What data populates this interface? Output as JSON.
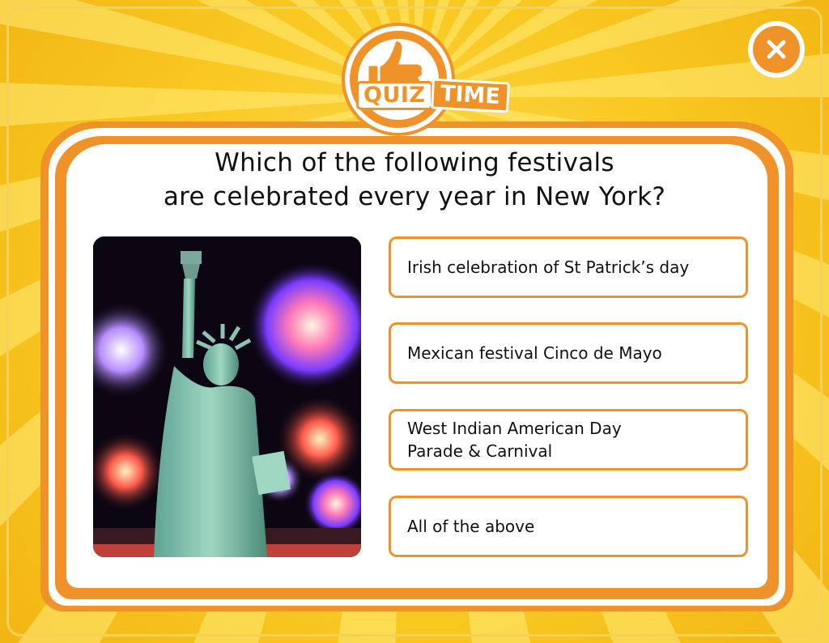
{
  "badge": {
    "quiz": "QUIZ",
    "time": "TIME"
  },
  "question": {
    "line1": "Which of the following festivals",
    "line2": "are celebrated every year in New York?"
  },
  "image": {
    "subject": "statue-of-liberty-fireworks"
  },
  "options": [
    {
      "label": "Irish celebration of St Patrick’s day"
    },
    {
      "label": "Mexican festival Cinco de Mayo"
    },
    {
      "label": "West Indian American Day\nParade & Carnival"
    },
    {
      "label": "All of the above"
    }
  ],
  "colors": {
    "accent": "#f0922a",
    "background": "#f6c21c",
    "card": "#ffffff"
  },
  "icons": {
    "close": "close-icon",
    "badge": "thumbs-up-icon"
  }
}
